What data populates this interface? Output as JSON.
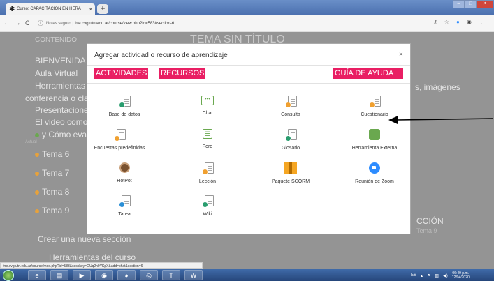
{
  "browser": {
    "tab_title": "Curso: CAPACITACIÓN EN HERA",
    "tab_close": "×",
    "newtab": "+",
    "nav": {
      "back": "←",
      "forward": "→",
      "reload": "C",
      "info": "ⓘ"
    },
    "url_secure": "No es seguro",
    "url": "frre.cvg.utn.edu.ar/course/view.php?id=583#section-6",
    "window_controls": [
      "–",
      "□",
      "✕"
    ]
  },
  "background": {
    "contenido": "CONTENIDO",
    "tema_title": "TEMA SIN TÍTULO",
    "bienvenida": "BIENVENIDA",
    "aula": "Aula Virtual",
    "herramientas": "Herramientas",
    "conferencia": "conferencia o cla",
    "presentaciones": "Presentacione",
    "video": "El video como",
    "como_eval": "y Cómo eval",
    "actual": "Actual",
    "tema6": "Tema 6",
    "tema7": "Tema 7",
    "tema8": "Tema 8",
    "tema9": "Tema 9",
    "crear": "Crear una nueva sección",
    "herramientas_curso": "Herramientas del curso",
    "imagenes": "s, imágenes",
    "seccion": "CCIÓN",
    "tema9_right": "Tema 9"
  },
  "modal": {
    "title": "Agregar actividad o recurso de aprendizaje",
    "close": "×",
    "tabs": {
      "actividades": "ACTIVIDADES",
      "recursos": "RECURSOS",
      "ayuda": "GUÍA DE AYUDA"
    },
    "items": [
      {
        "label": "Base de datos",
        "icon": "database-icon",
        "color": "#2a9d6f"
      },
      {
        "label": "Chat",
        "icon": "chat-icon",
        "color": "#6aa84f"
      },
      {
        "label": "Consulta",
        "icon": "choice-icon",
        "color": "#f0a030"
      },
      {
        "label": "Cuestionario",
        "icon": "quiz-icon",
        "color": "#f0a030"
      },
      {
        "label": "Encuestas predefinidas",
        "icon": "survey-icon",
        "color": "#f0a030"
      },
      {
        "label": "Foro",
        "icon": "forum-icon",
        "color": "#6aa84f"
      },
      {
        "label": "Glosario",
        "icon": "glossary-icon",
        "color": "#2a9d6f"
      },
      {
        "label": "Herramienta Externa",
        "icon": "puzzle-icon",
        "color": "#6aa84f"
      },
      {
        "label": "HotPot",
        "icon": "hotpot-icon",
        "color": "#7a5230"
      },
      {
        "label": "Lección",
        "icon": "lesson-icon",
        "color": "#f0a030"
      },
      {
        "label": "Paquete SCORM",
        "icon": "scorm-icon",
        "color": "#f5a623"
      },
      {
        "label": "Reunión de Zoom",
        "icon": "zoom-icon",
        "color": "#2d8cff"
      },
      {
        "label": "Tarea",
        "icon": "assignment-icon",
        "color": "#2a8fd6"
      },
      {
        "label": "Wiki",
        "icon": "wiki-icon",
        "color": "#2a9d6f"
      }
    ]
  },
  "status_url": "frre.cvg.utn.edu.ar/course/mod.php?id=583&sesskey=GUq2h9YKpX&add=chat&section=6",
  "taskbar": {
    "lang": "ES",
    "time": "06:49 p.m.",
    "date": "12/04/2020"
  },
  "colors": {
    "accent": "#e91e63"
  }
}
